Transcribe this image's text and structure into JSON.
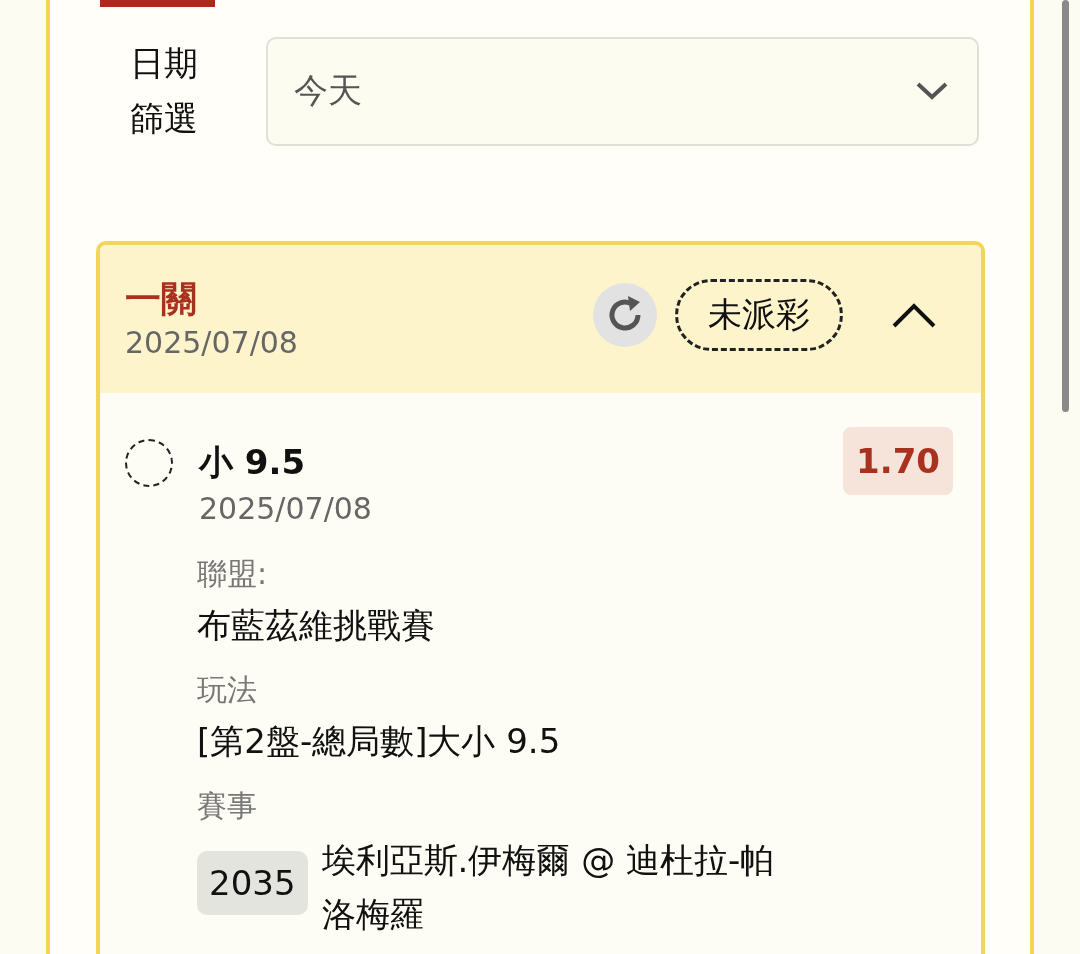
{
  "filter": {
    "label": "日期篩選",
    "value": "今天"
  },
  "bet_card": {
    "title": "一關",
    "date": "2025/07/08",
    "status": "未派彩",
    "expanded": true,
    "selection": {
      "selected": false,
      "pick": "小 9.5",
      "date": "2025/07/08",
      "odds": "1.70",
      "fields": [
        {
          "label": "聯盟:",
          "value": "布藍茲維挑戰賽"
        },
        {
          "label": "玩法",
          "value": "[第2盤-總局數]大小 9.5"
        }
      ],
      "event": {
        "label": "賽事",
        "number": "2035",
        "match": "埃利亞斯.伊梅爾 @ 迪杜拉-帕洛梅羅"
      }
    }
  }
}
